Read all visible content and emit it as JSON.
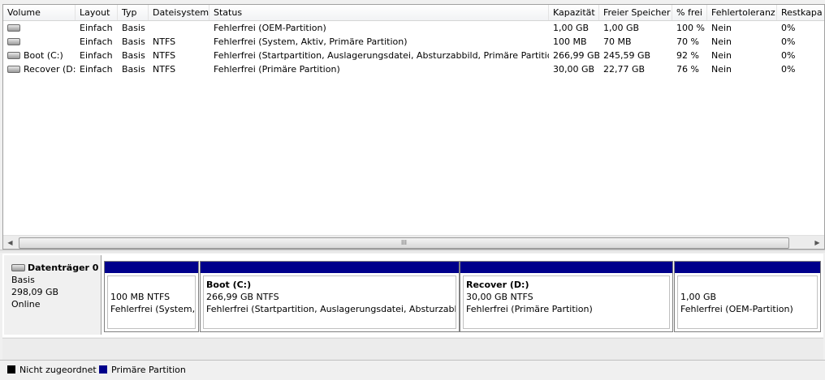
{
  "columns": [
    "Volume",
    "Layout",
    "Typ",
    "Dateisystem",
    "Status",
    "Kapazität",
    "Freier Speicher",
    "% frei",
    "Fehlertoleranz",
    "Restkapa"
  ],
  "rows": [
    {
      "volume": "",
      "layout": "Einfach",
      "typ": "Basis",
      "fs": "",
      "status": "Fehlerfrei (OEM-Partition)",
      "kap": "1,00 GB",
      "frei": "1,00 GB",
      "pct": "100 %",
      "fehler": "Nein",
      "rest": "0%"
    },
    {
      "volume": "",
      "layout": "Einfach",
      "typ": "Basis",
      "fs": "NTFS",
      "status": "Fehlerfrei (System, Aktiv, Primäre Partition)",
      "kap": "100 MB",
      "frei": "70 MB",
      "pct": "70 %",
      "fehler": "Nein",
      "rest": "0%"
    },
    {
      "volume": "Boot (C:)",
      "layout": "Einfach",
      "typ": "Basis",
      "fs": "NTFS",
      "status": "Fehlerfrei (Startpartition, Auslagerungsdatei, Absturzabbild, Primäre Partition)",
      "kap": "266,99 GB",
      "frei": "245,59 GB",
      "pct": "92 %",
      "fehler": "Nein",
      "rest": "0%"
    },
    {
      "volume": "Recover (D:)",
      "layout": "Einfach",
      "typ": "Basis",
      "fs": "NTFS",
      "status": "Fehlerfrei (Primäre Partition)",
      "kap": "30,00 GB",
      "frei": "22,77 GB",
      "pct": "76 %",
      "fehler": "Nein",
      "rest": "0%"
    }
  ],
  "disk": {
    "name": "Datenträger 0",
    "type": "Basis",
    "size": "298,09 GB",
    "state": "Online"
  },
  "partitions": [
    {
      "name": "",
      "size": "100 MB NTFS",
      "status": "Fehlerfrei (System, Aktiv, Primäre Partition)"
    },
    {
      "name": "Boot  (C:)",
      "size": "266,99 GB NTFS",
      "status": "Fehlerfrei (Startpartition, Auslagerungsdatei, Absturzabbild, Primäre Partition)"
    },
    {
      "name": "Recover  (D:)",
      "size": "30,00 GB NTFS",
      "status": "Fehlerfrei (Primäre Partition)"
    },
    {
      "name": "",
      "size": "1,00 GB",
      "status": "Fehlerfrei (OEM-Partition)"
    }
  ],
  "legend": [
    {
      "label": "Nicht zugeordnet",
      "color": "#000000"
    },
    {
      "label": "Primäre Partition",
      "color": "#00008b"
    }
  ],
  "scroll_grip": "III"
}
